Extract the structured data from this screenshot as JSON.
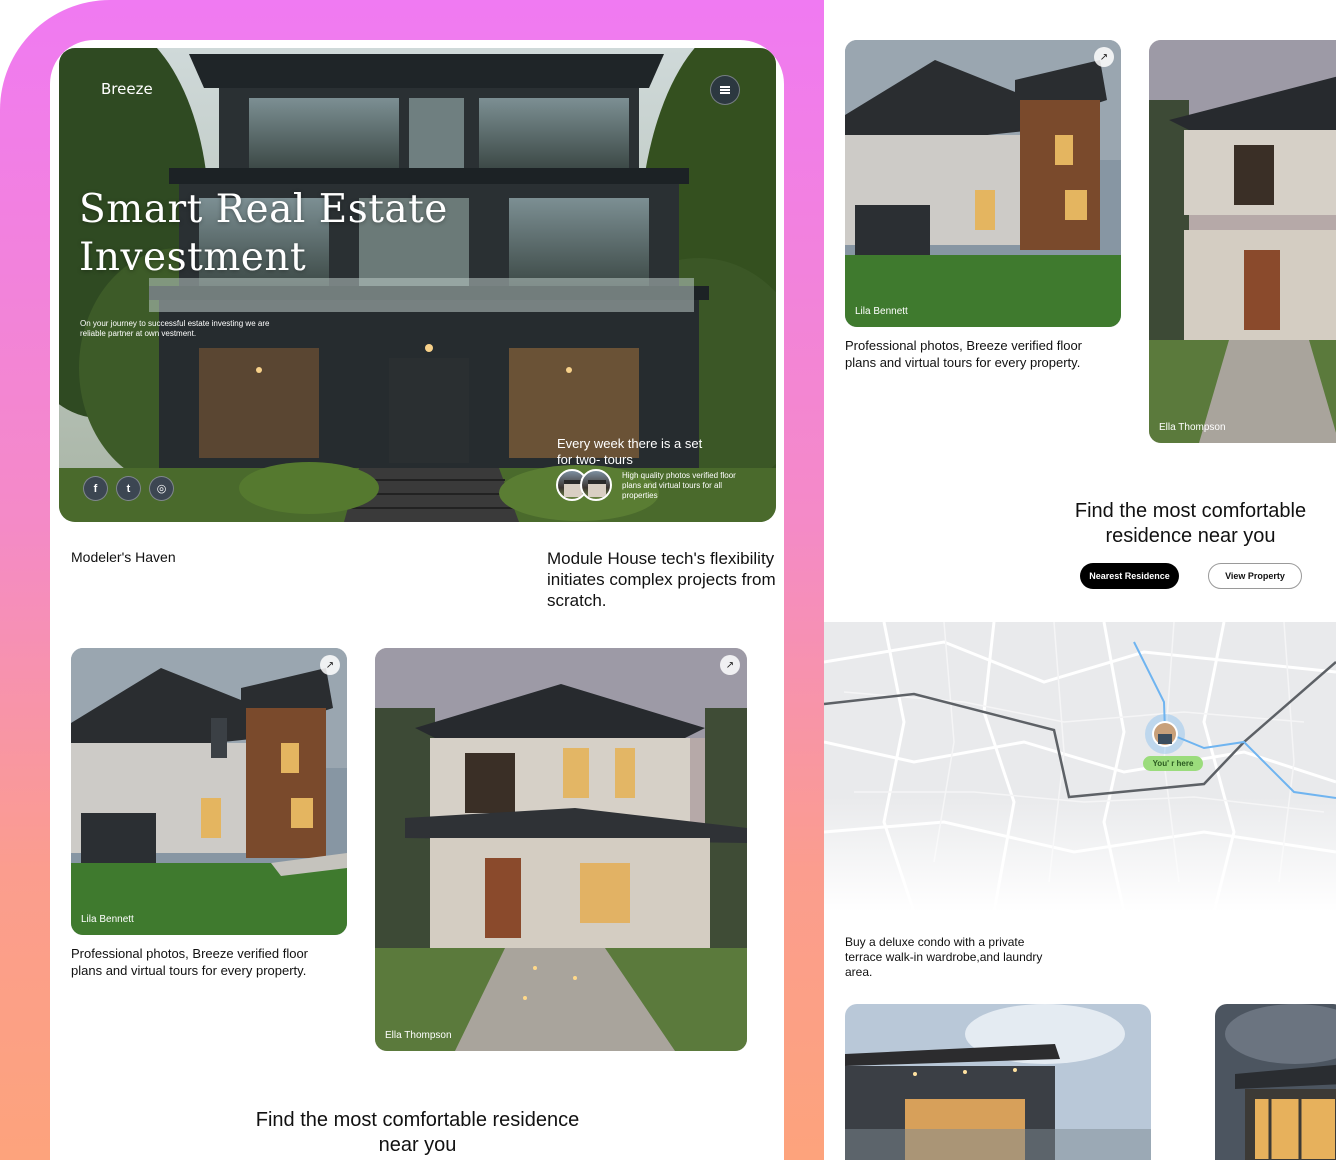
{
  "brand": "Breeze",
  "hero": {
    "title": "Smart Real Estate Investment",
    "subtitle": "On your journey to successful estate investing we are reliable partner at own vestment.",
    "week_title": "Every week there is a set for two- tours",
    "week_sub": "High quality photos verified floor plans and virtual tours for all properties",
    "socials": [
      {
        "icon": "facebook-icon",
        "glyph": "f"
      },
      {
        "icon": "twitter-icon",
        "glyph": "t"
      },
      {
        "icon": "instagram-icon",
        "glyph": "◎"
      }
    ]
  },
  "section_a": {
    "title": "Modeler's Haven",
    "description": "Module House tech's flexibility initiates complex projects from scratch."
  },
  "cards": [
    {
      "name": "Lila Bennett",
      "arrow": "↗",
      "caption": "Professional photos, Breeze verified floor plans and virtual tours for every property."
    },
    {
      "name": "Ella Thompson",
      "arrow": "↗"
    }
  ],
  "find": {
    "title": "Find the most comfortable residence near you",
    "primary_button": "Nearest Residence",
    "secondary_button": "View Property"
  },
  "map": {
    "marker_label": "You' r here"
  },
  "right_desc": "Buy a deluxe condo with a private terrace walk-in wardrobe,and laundry area.",
  "colors": {
    "gradient_top": "#f07af2",
    "gradient_bottom": "#fda37c",
    "marker_green": "#9bdc7c",
    "route_blue": "#6fb4f0"
  }
}
